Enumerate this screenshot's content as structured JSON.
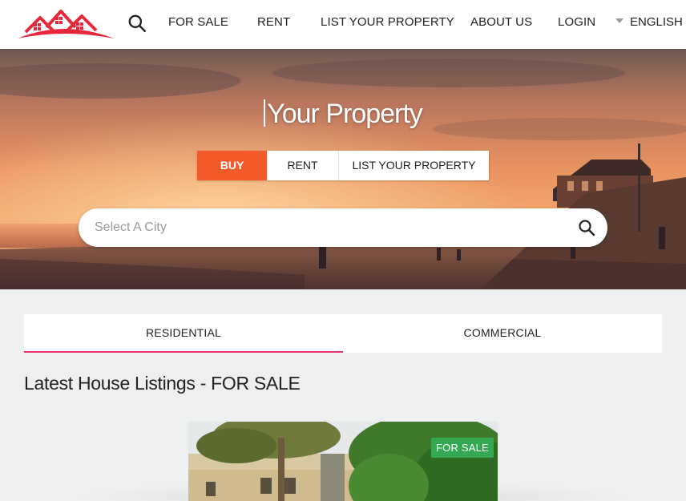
{
  "nav": {
    "items": [
      "FOR SALE",
      "RENT",
      "LIST YOUR PROPERTY",
      "ABOUT US",
      "LOGIN"
    ],
    "language": "ENGLISH"
  },
  "hero": {
    "title": "Your Property",
    "modes": [
      "BUY",
      "RENT",
      "LIST YOUR PROPERTY"
    ],
    "active_mode": "BUY",
    "search_placeholder": "Select A City"
  },
  "category_tabs": [
    "RESIDENTIAL",
    "COMMERCIAL"
  ],
  "active_category": "RESIDENTIAL",
  "listings_title": "Latest House Listings - FOR SALE",
  "listing": {
    "badge": "FOR SALE"
  },
  "colors": {
    "accent": "#f25a2a",
    "tab_underline": "#e8336b",
    "badge_green": "#34a853",
    "logo_red": "#e8283a"
  }
}
